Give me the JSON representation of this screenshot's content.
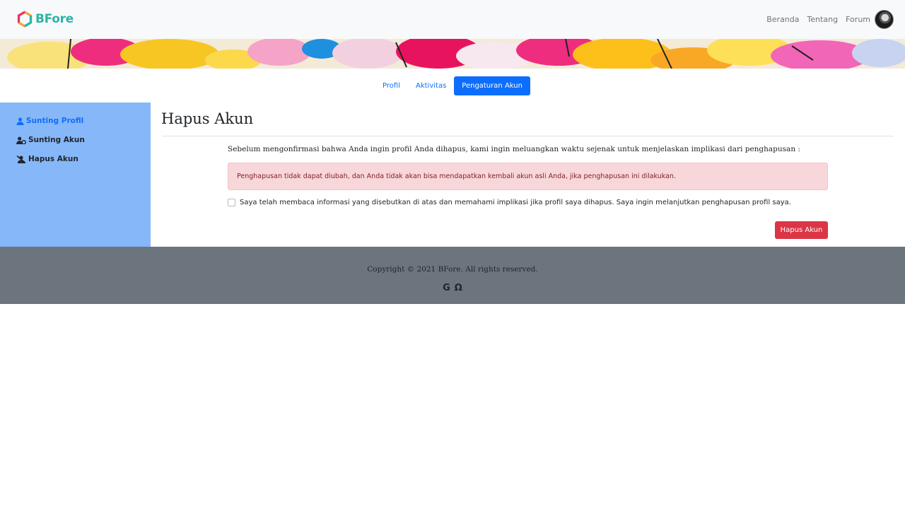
{
  "brand": {
    "name": "BFore",
    "logo_icon": "hexagon-logo-icon",
    "color": "#2bb5a6"
  },
  "nav": {
    "items": [
      "Beranda",
      "Tentang",
      "Forum"
    ],
    "avatar": "user-avatar"
  },
  "tabs": [
    {
      "label": "Profil",
      "active": false
    },
    {
      "label": "Aktivitas",
      "active": false
    },
    {
      "label": "Pengaturan Akun",
      "active": true
    }
  ],
  "sidebar": {
    "items": [
      {
        "label": "Sunting Profil",
        "icon": "user-icon",
        "active": true
      },
      {
        "label": "Sunting Akun",
        "icon": "user-gear-icon",
        "active": false
      },
      {
        "label": "Hapus Akun",
        "icon": "user-slash-icon",
        "active": false
      }
    ]
  },
  "main": {
    "title": "Hapus Akun",
    "intro": "Sebelum mengonfirmasi bahwa Anda ingin profil Anda dihapus, kami ingin meluangkan waktu sejenak untuk menjelaskan implikasi dari penghapusan :",
    "alert": "Penghapusan tidak dapat diubah, dan Anda tidak akan bisa mendapatkan kembali akun asli Anda, jika penghapusan ini dilakukan.",
    "consent": "Saya telah membaca informasi yang disebutkan di atas dan memahami implikasi jika profil saya dihapus. Saya ingin melanjutkan penghapusan profil saya.",
    "delete_button": "Hapus Akun"
  },
  "footer": {
    "copyright": "Copyright © 2021 BFore. All rights reserved.",
    "icons": [
      {
        "name": "google-icon",
        "glyph": "G"
      },
      {
        "name": "omega-icon",
        "glyph": "Ω"
      }
    ]
  },
  "colors": {
    "primary": "#0d6efd",
    "danger": "#dc3545",
    "sidebar_bg": "#86b7f8",
    "footer_bg": "#6c757d",
    "alert_bg": "#f8d7da"
  }
}
